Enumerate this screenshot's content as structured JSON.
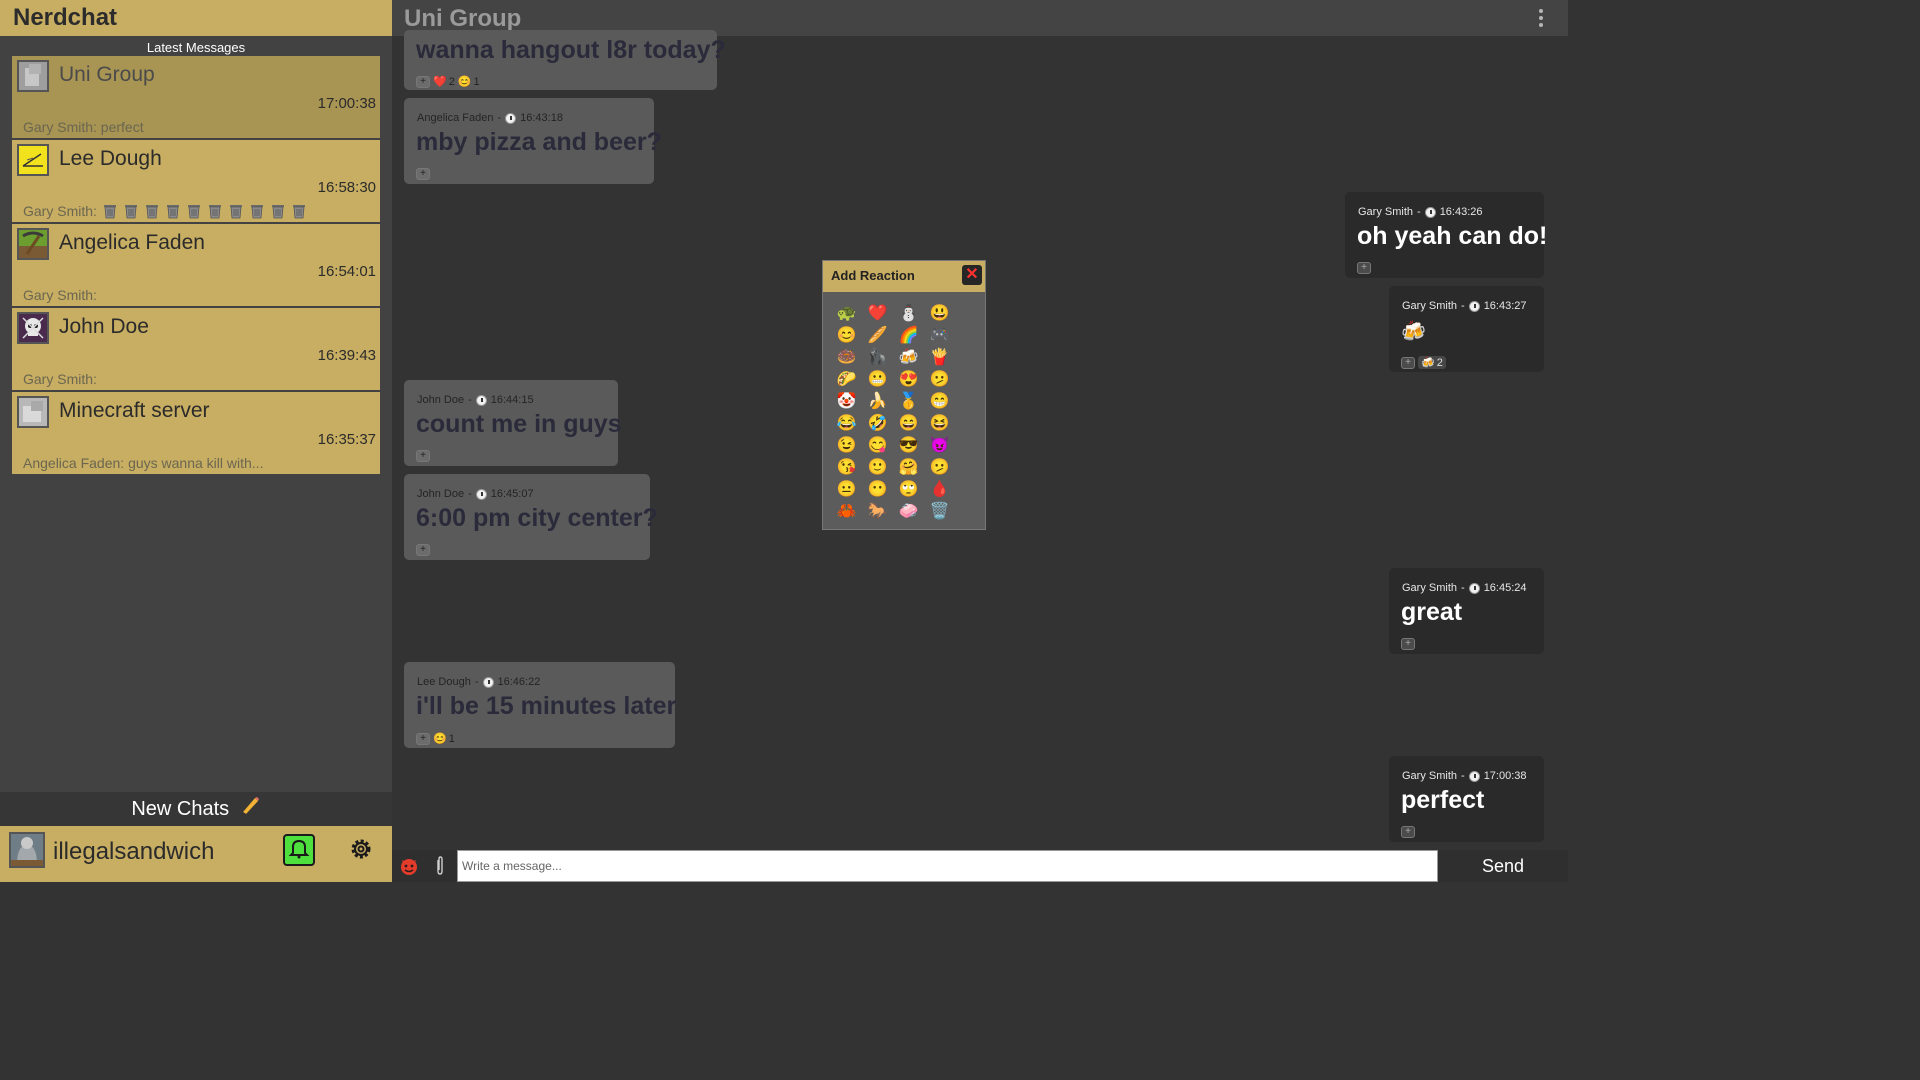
{
  "app": {
    "title": "Nerdchat",
    "latest_label": "Latest Messages"
  },
  "chats": [
    {
      "name": "Uni Group",
      "time": "17:00:38",
      "preview": "Gary Smith: perfect",
      "active": true,
      "avatar": "gray-avatar-icon"
    },
    {
      "name": "Lee Dough",
      "time": "16:58:30",
      "preview": "Gary Smith:",
      "preview_icon": "trash-icon",
      "preview_icon_count": 10,
      "avatar": "yellow-sketch-avatar-icon"
    },
    {
      "name": "Angelica Faden",
      "time": "16:54:01",
      "preview": "Gary Smith:",
      "avatar": "pickaxe-avatar-icon"
    },
    {
      "name": "John Doe",
      "time": "16:39:43",
      "preview": "Gary Smith:",
      "avatar": "skull-avatar-icon"
    },
    {
      "name": "Minecraft server",
      "time": "16:35:37",
      "preview": "Angelica Faden: guys wanna kill with...",
      "avatar": "gray-avatar-icon"
    }
  ],
  "sidebar": {
    "new_chats": "New Chats"
  },
  "user": {
    "name": "illegalsandwich",
    "bell_color": "#4ee03c"
  },
  "group": {
    "title": "Uni Group"
  },
  "messages": [
    {
      "text": "wanna hangout l8r today?",
      "reactions": [
        {
          "emoji": "❤️",
          "count": "2"
        },
        {
          "emoji": "😊",
          "count": "1"
        }
      ]
    },
    {
      "sender": "Angelica Faden",
      "time": "16:43:18",
      "text": "mby pizza and beer?",
      "reactions": []
    },
    {
      "sender": "Gary Smith",
      "time": "16:43:26",
      "text": "oh yeah can do!",
      "reactions": []
    },
    {
      "sender": "Gary Smith",
      "time": "16:43:27",
      "text": "🍻",
      "reactions": [
        {
          "emoji": "🍻",
          "count": "2"
        }
      ]
    },
    {
      "sender": "John Doe",
      "time": "16:44:15",
      "text": "count me in guys",
      "reactions": []
    },
    {
      "sender": "John Doe",
      "time": "16:45:07",
      "text": "6:00 pm city center?",
      "reactions": []
    },
    {
      "sender": "Gary Smith",
      "time": "16:45:24",
      "text": "great",
      "reactions": []
    },
    {
      "sender": "Lee Dough",
      "time": "16:46:22",
      "text": "i'll be 15 minutes later",
      "reactions": [
        {
          "emoji": "😊",
          "count": "1"
        }
      ]
    },
    {
      "sender": "Gary Smith",
      "time": "17:00:38",
      "text": "perfect",
      "reactions": []
    }
  ],
  "reaction_popup": {
    "title": "Add Reaction",
    "close": "✕",
    "emojis": [
      "🐢",
      "❤️",
      "⛄",
      "😃",
      "😊",
      "🥖",
      "🌈",
      "🎮",
      "🍩",
      "🦍",
      "🍻",
      "🍟",
      "🌮",
      "😬",
      "😍",
      "🫤",
      "🤡",
      "🍌",
      "🥇",
      "😁",
      "😂",
      "🤣",
      "😄",
      "😆",
      "😉",
      "😋",
      "😎",
      "😈",
      "😘",
      "🙂",
      "🤗",
      "🫤",
      "😐",
      "😶",
      "🙄",
      "🩸",
      "🦀",
      "🐎",
      "🧼",
      "🗑️"
    ]
  },
  "composer": {
    "placeholder": "Write a message...",
    "send": "Send"
  }
}
